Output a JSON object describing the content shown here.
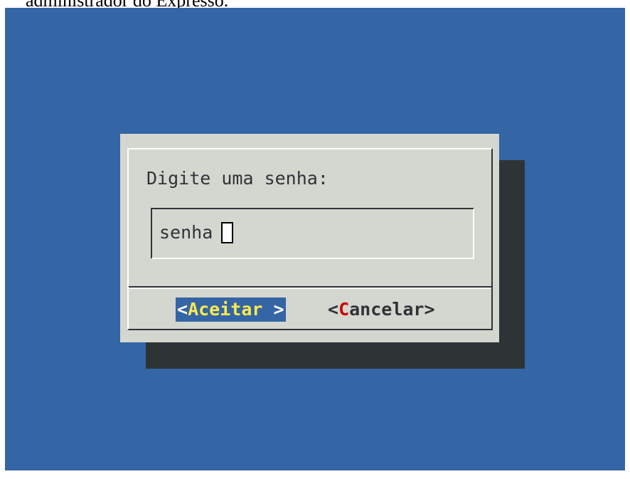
{
  "caption": "administrador do Expresso.",
  "dialog": {
    "prompt": "Digite uma senha:",
    "input_value": "senha"
  },
  "buttons": {
    "ok": {
      "open": "<",
      "hotkey": "A",
      "rest": "ceitar",
      "close": " >"
    },
    "cancel": {
      "open": "<",
      "hotkey": "C",
      "rest": "ancelar",
      "close": ">"
    }
  },
  "colors": {
    "terminal_bg": "#3465a4",
    "dialog_bg": "#d3d7cf",
    "shadow": "#2e3436",
    "hotkey_ok": "#fce94f",
    "hotkey_cancel": "#cc0000"
  }
}
